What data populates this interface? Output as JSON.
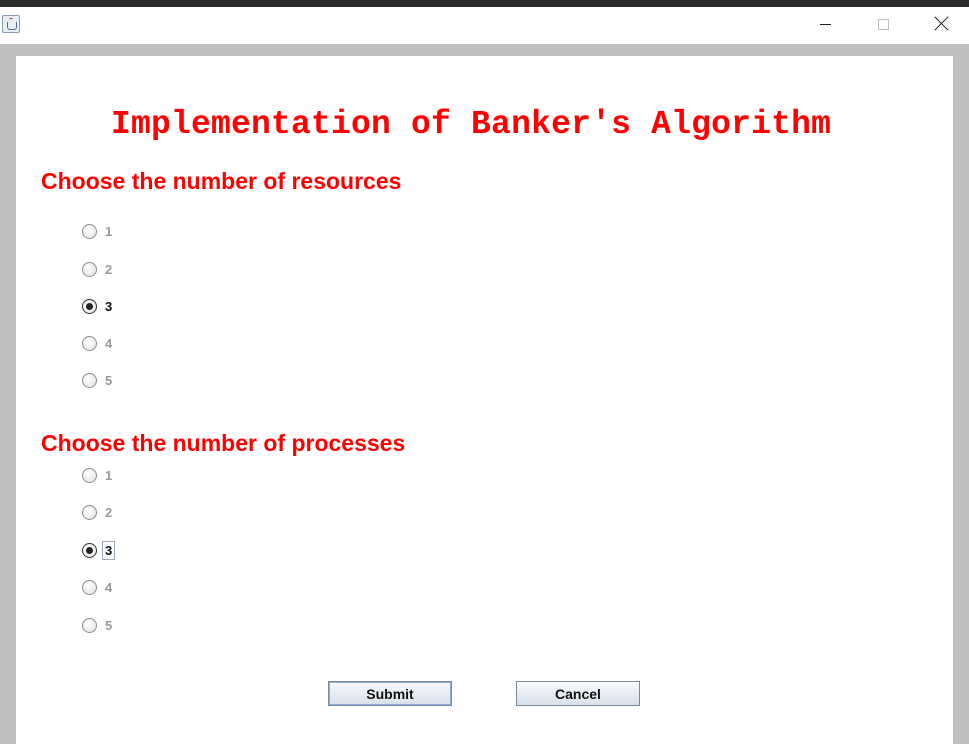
{
  "window": {
    "minimize_icon": "minimize-icon",
    "maximize_icon": "maximize-icon",
    "close_icon": "close-icon",
    "app_icon": "java-app-icon"
  },
  "app": {
    "title": "Implementation of Banker's Algorithm"
  },
  "resources": {
    "heading": "Choose the number of resources",
    "options": [
      "1",
      "2",
      "3",
      "4",
      "5"
    ],
    "selected": "3"
  },
  "processes": {
    "heading": "Choose the number of processes",
    "options": [
      "1",
      "2",
      "3",
      "4",
      "5"
    ],
    "selected": "3"
  },
  "buttons": {
    "submit": "Submit",
    "cancel": "Cancel"
  },
  "colors": {
    "heading": "#ff0000",
    "window_bg": "#c0c0c0",
    "panel_bg": "#ffffff"
  }
}
